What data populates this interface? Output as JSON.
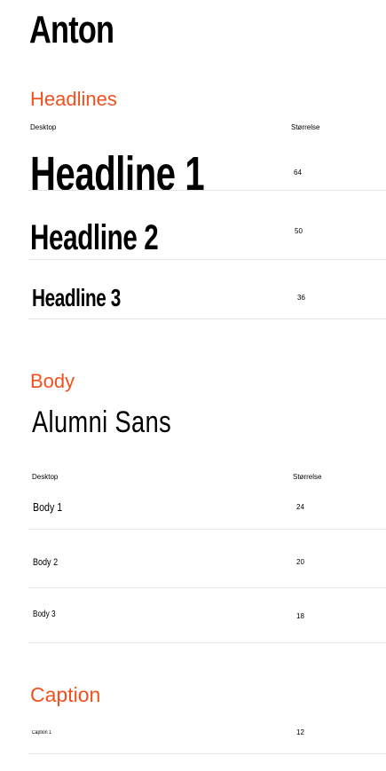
{
  "typeface_primary": "Anton",
  "typeface_secondary": "Alumni Sans",
  "accent_color": "#f2501d",
  "headlines": {
    "heading": "Headlines",
    "col_desktop": "Desktop",
    "col_size": "Størrelse",
    "rows": [
      {
        "label": "Headline 1",
        "size": "64"
      },
      {
        "label": "Headline 2",
        "size": "50"
      },
      {
        "label": "Headline 3",
        "size": "36"
      }
    ]
  },
  "body": {
    "heading": "Body",
    "col_desktop": "Desktop",
    "col_size": "Størrelse",
    "rows": [
      {
        "label": "Body 1",
        "size": "24"
      },
      {
        "label": "Body 2",
        "size": "20"
      },
      {
        "label": "Body 3",
        "size": "18"
      }
    ]
  },
  "caption": {
    "heading": "Caption",
    "rows": [
      {
        "label": "Caption 1",
        "size": "12"
      }
    ]
  }
}
